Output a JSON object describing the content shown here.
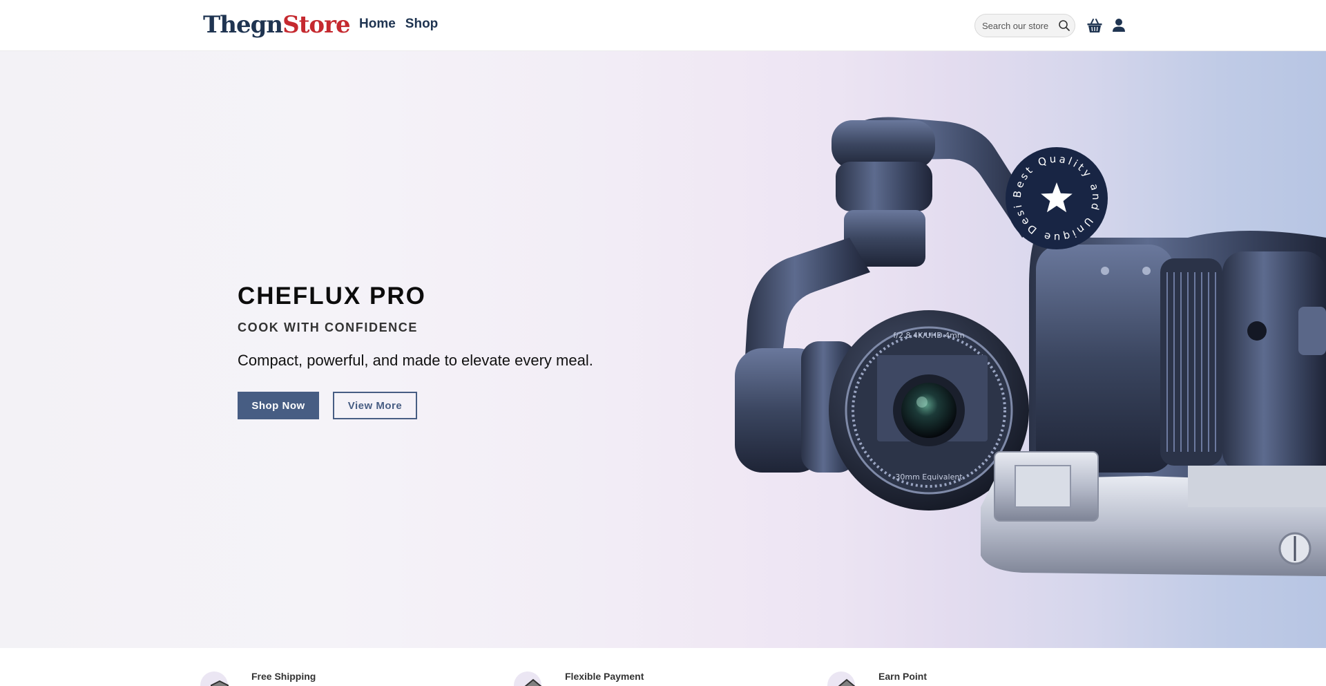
{
  "header": {
    "logo_part1": "Thegn",
    "logo_part2": "Store",
    "nav": [
      "Home",
      "Shop"
    ],
    "search_placeholder": "Search our store"
  },
  "hero": {
    "title": "CHEFLUX PRO",
    "subtitle": "COOK WITH CONFIDENCE",
    "description": "Compact, powerful, and made to elevate every meal.",
    "primary_button": "Shop Now",
    "secondary_button": "View More",
    "badge_text": "Best Quality and Unique Design -",
    "lens_text_top": "f/2.8 4K/UHD 4mm",
    "lens_text_bottom": "30mm Equivalent"
  },
  "features": [
    {
      "title": "Free Shipping"
    },
    {
      "title": "Flexible Payment"
    },
    {
      "title": "Earn Point"
    }
  ],
  "colors": {
    "brand_navy": "#1f3451",
    "brand_red": "#c5292f",
    "button_blue": "#475d83",
    "badge_dark": "#182544"
  },
  "icons": [
    "search-icon",
    "basket-icon",
    "user-icon",
    "star-icon",
    "shipping-icon",
    "payment-icon",
    "points-icon"
  ]
}
